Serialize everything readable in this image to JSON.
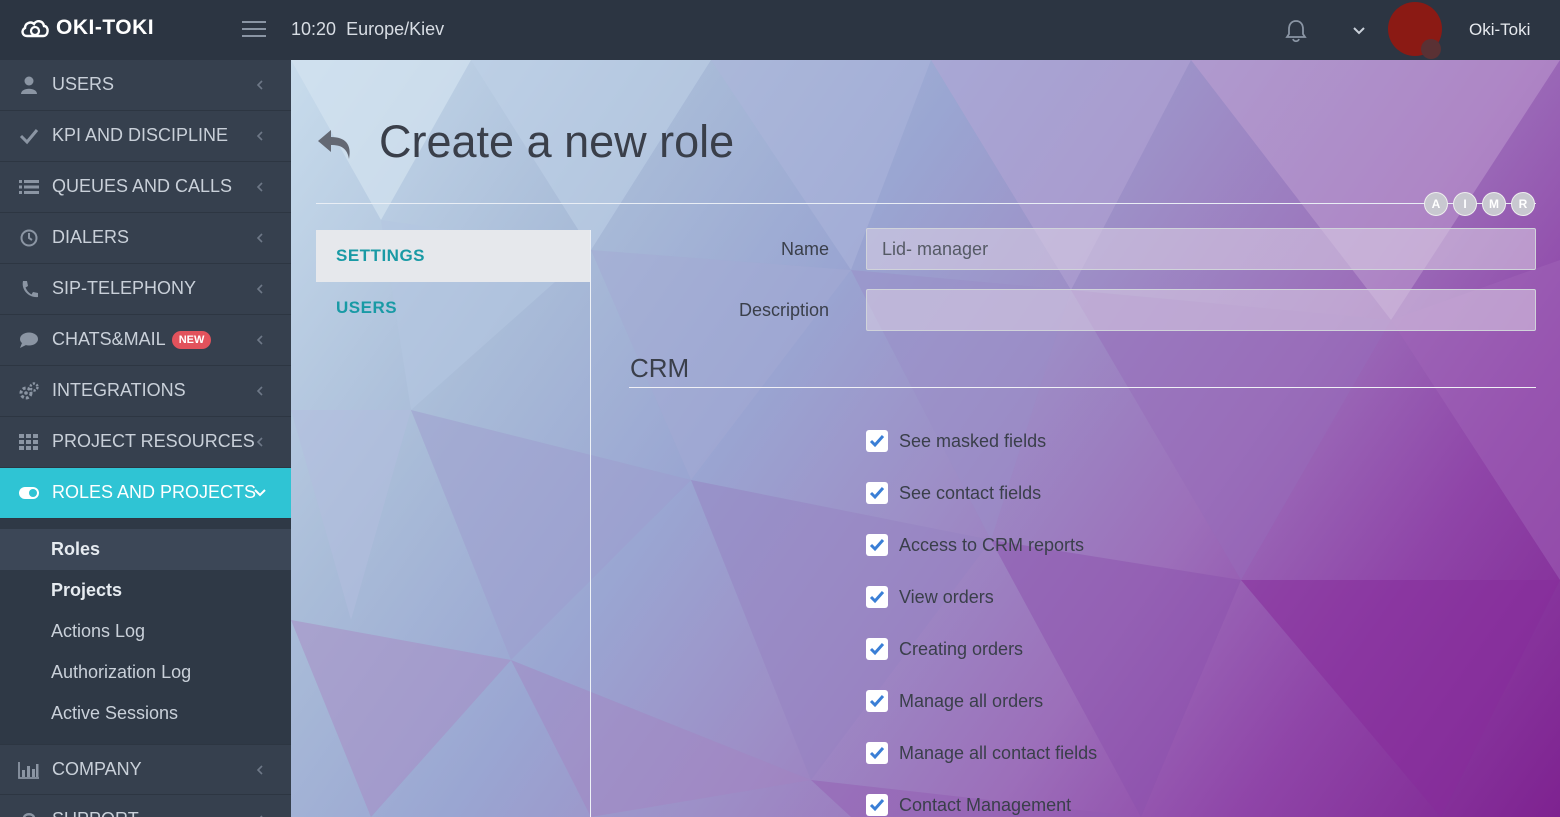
{
  "app": {
    "brand": "OKI-TOKI",
    "time": "10:20",
    "timezone": "Europe/Kiev",
    "user": "Oki-Toki"
  },
  "sidebar": {
    "items": [
      {
        "label": "USERS",
        "icon": "user-icon"
      },
      {
        "label": "KPI AND DISCIPLINE",
        "icon": "check-icon"
      },
      {
        "label": "QUEUES AND CALLS",
        "icon": "list-icon"
      },
      {
        "label": "DIALERS",
        "icon": "clock-icon"
      },
      {
        "label": "SIP-TELEPHONY",
        "icon": "phone-icon"
      },
      {
        "label": "CHATS&MAIL",
        "icon": "chat-icon",
        "badge": "NEW"
      },
      {
        "label": "INTEGRATIONS",
        "icon": "gears-icon"
      },
      {
        "label": "PROJECT RESOURCES",
        "icon": "grid-icon"
      },
      {
        "label": "ROLES AND PROJECTS",
        "icon": "toggle-icon",
        "active": true
      }
    ],
    "submenu": [
      {
        "label": "Roles"
      },
      {
        "label": "Projects"
      },
      {
        "label": "Actions Log"
      },
      {
        "label": "Authorization Log"
      },
      {
        "label": "Active Sessions"
      }
    ],
    "after": [
      {
        "label": "COMPANY",
        "icon": "bar-chart-icon"
      },
      {
        "label": "SUPPORT",
        "icon": "support-icon"
      }
    ]
  },
  "main": {
    "title": "Create a new role",
    "letters": [
      "A",
      "I",
      "M",
      "R"
    ],
    "tabs": [
      {
        "label": "SETTINGS"
      },
      {
        "label": "USERS"
      }
    ],
    "form": {
      "name_label": "Name",
      "name_value": "Lid- manager",
      "description_label": "Description",
      "description_value": ""
    },
    "section": "CRM",
    "checks": [
      {
        "label": "See masked fields",
        "checked": true
      },
      {
        "label": "See contact fields",
        "checked": true
      },
      {
        "label": "Access to CRM reports",
        "checked": true
      },
      {
        "label": "View orders",
        "checked": true
      },
      {
        "label": "Creating orders",
        "checked": true
      },
      {
        "label": "Manage all orders",
        "checked": true
      },
      {
        "label": "Manage all contact fields",
        "checked": true
      },
      {
        "label": "Contact Management",
        "checked": true
      }
    ]
  },
  "colors": {
    "accent": "#2fc4d4",
    "sidebar": "#36404e",
    "topbar": "#2c3542",
    "badge": "#e2525c",
    "check": "#3a7fd6"
  }
}
